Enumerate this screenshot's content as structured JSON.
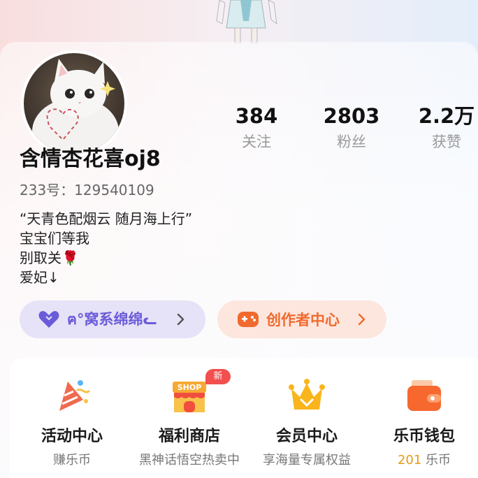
{
  "profile": {
    "stats": [
      {
        "value": "384",
        "label": "关注"
      },
      {
        "value": "2803",
        "label": "粉丝"
      },
      {
        "value": "2.2万",
        "label": "获赞"
      }
    ],
    "name": "含情杏花喜oj8",
    "uid": "233号：129540109",
    "bio": [
      "“天青色配烟云 随月海上行”",
      "宝宝们等我",
      "别取关🌹",
      "爱妃↓"
    ]
  },
  "actions": {
    "group_label": "ฅ°窝系绵绵ᓚ",
    "creator_label": "创作者中心"
  },
  "services": [
    {
      "title": "活动中心",
      "subtitle": "赚乐币"
    },
    {
      "title": "福利商店",
      "subtitle": "黑神话悟空热卖中",
      "badge": "新",
      "icon_text": "SHOP"
    },
    {
      "title": "会员中心",
      "subtitle": "享海量专属权益"
    },
    {
      "title": "乐币钱包",
      "subtitle_value": "201",
      "subtitle_unit": "乐币"
    }
  ],
  "colors": {
    "accent_purple": "#6a5bd8",
    "accent_orange": "#f06a2e",
    "badge_red": "#f24f4f",
    "coin_orange": "#e69b12"
  }
}
